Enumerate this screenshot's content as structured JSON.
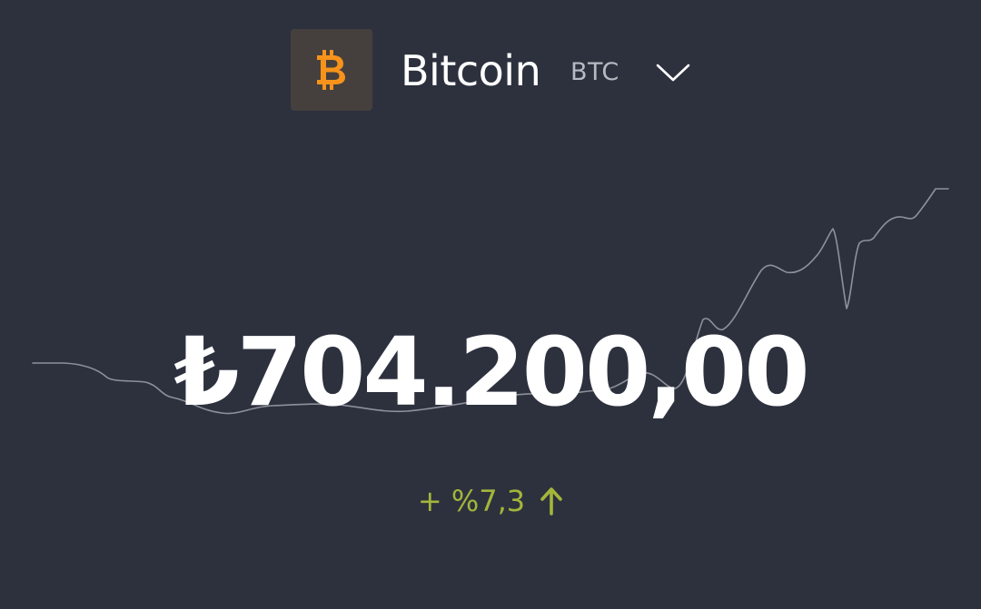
{
  "coin": {
    "name": "Bitcoin",
    "symbol": "BTC",
    "logo_icon": "bitcoin-icon",
    "logo_color": "#f7931a",
    "logo_background": "#45403e"
  },
  "selector": {
    "icon": "chevron-down-icon"
  },
  "price": {
    "display": "₺704.200,00"
  },
  "change": {
    "text": "+ %7,3",
    "direction": "up",
    "icon": "arrow-up-icon",
    "color": "#a3b63a"
  },
  "theme": {
    "background": "#2d313e",
    "sparkline_color": "#8d919b"
  }
}
